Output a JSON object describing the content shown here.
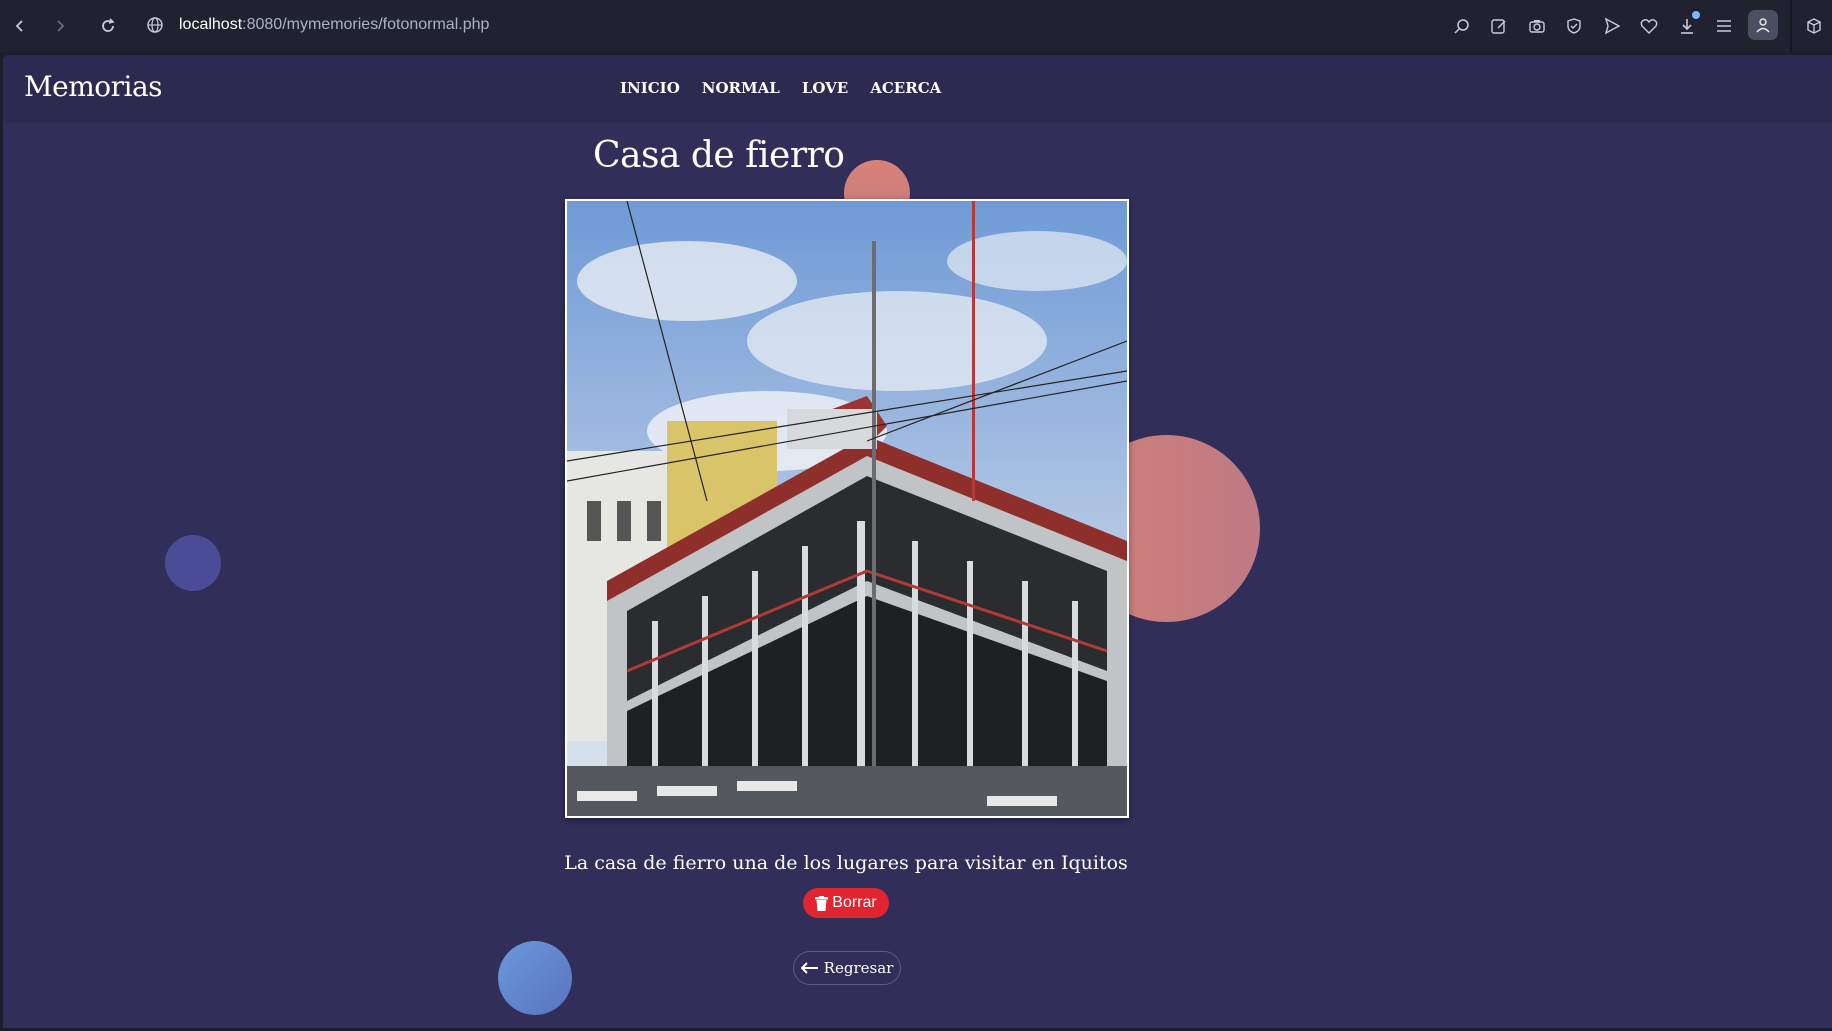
{
  "browser": {
    "url_host": "localhost",
    "url_path": ":8080/mymemories/fotonormal.php"
  },
  "site": {
    "brand": "Memorias",
    "menu": [
      "INICIO",
      "NORMAL",
      "LOVE",
      "ACERCA"
    ]
  },
  "photo": {
    "title": "Casa de fierro",
    "caption": "La casa de fierro una de los lugares para visitar en Iquitos"
  },
  "actions": {
    "delete_label": "Borrar",
    "back_label": "Regresar"
  },
  "colors": {
    "page_bg": "#312e5a",
    "navbar_bg": "#2c2a51",
    "delete_btn": "#e02430"
  }
}
